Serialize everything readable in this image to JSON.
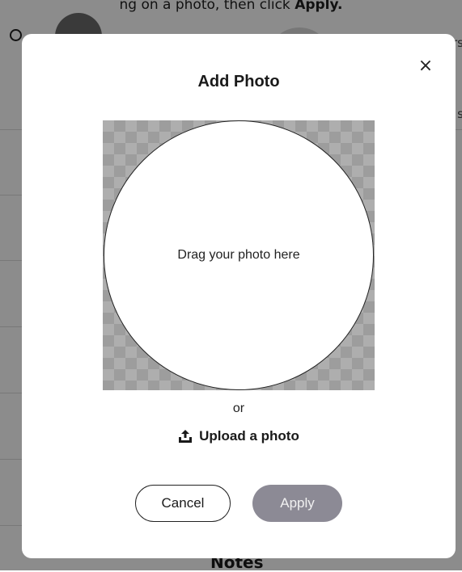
{
  "background": {
    "top_text_prefix": "ng on a photo, then click",
    "top_text_bold": "Apply.",
    "right_fragment_1": "rs",
    "right_fragment_2": "s",
    "notes_label": "Notes"
  },
  "modal": {
    "title": "Add Photo",
    "close_symbol": "×",
    "dropzone_text": "Drag your photo here",
    "or_text": "or",
    "upload_label": "Upload a photo",
    "cancel_label": "Cancel",
    "apply_label": "Apply"
  },
  "icons": {
    "close": "close-icon",
    "upload": "upload-icon",
    "search": "search-icon"
  },
  "colors": {
    "apply_disabled_bg": "#8c8a95",
    "overlay": "rgba(0,0,0,0.45)",
    "checker_light": "#aeaeae",
    "checker_dark": "#9d9d9d"
  }
}
